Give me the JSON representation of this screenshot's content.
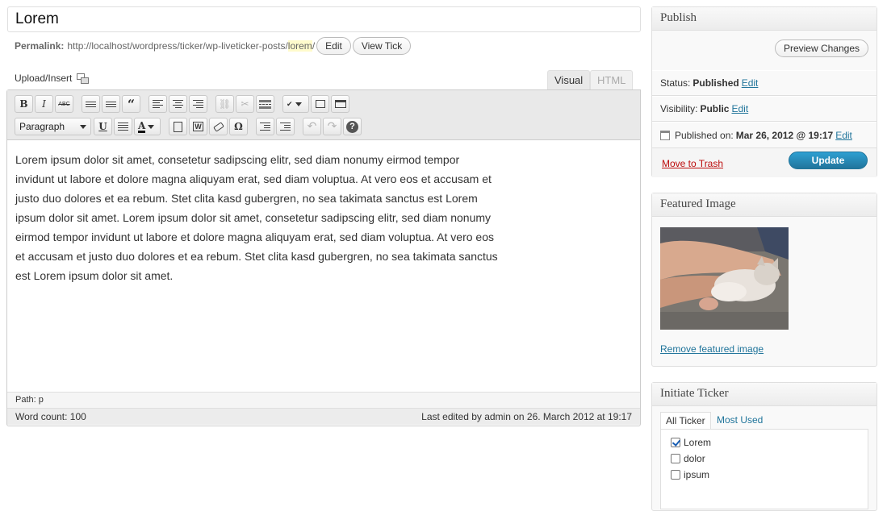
{
  "post": {
    "title": "Lorem",
    "permalink_label": "Permalink:",
    "permalink_base": "http://localhost/wordpress/ticker/wp-liveticker-posts/",
    "permalink_slug": "lorem",
    "permalink_trail": "/",
    "edit_label": "Edit",
    "view_label": "View Tick"
  },
  "editor": {
    "upload_label": "Upload/Insert",
    "tabs": [
      {
        "label": "Visual",
        "active": true
      },
      {
        "label": "HTML",
        "active": false
      }
    ],
    "format_select": "Paragraph",
    "toolbar_row1": [
      "bold-icon",
      "italic-icon",
      "strikethrough-icon",
      "bullet-list-icon",
      "numbered-list-icon",
      "blockquote-icon",
      "align-left-icon",
      "align-center-icon",
      "align-right-icon",
      "link-icon",
      "unlink-icon",
      "more-tag-icon",
      "spellcheck-icon",
      "fullscreen-icon",
      "kitchen-sink-icon"
    ],
    "toolbar_row2": [
      "underline-icon",
      "justify-icon",
      "text-color-icon",
      "paste-text-icon",
      "paste-word-icon",
      "clear-formatting-icon",
      "special-char-icon",
      "outdent-icon",
      "indent-icon",
      "undo-icon",
      "redo-icon",
      "help-icon"
    ],
    "content": "Lorem ipsum dolor sit amet, consetetur sadipscing elitr, sed diam nonumy eirmod tempor invidunt ut labore et dolore magna aliquyam erat, sed diam voluptua. At vero eos et accusam et justo duo dolores et ea rebum. Stet clita kasd gubergren, no sea takimata sanctus est Lorem ipsum dolor sit amet. Lorem ipsum dolor sit amet, consetetur sadipscing elitr, sed diam nonumy eirmod tempor invidunt ut labore et dolore magna aliquyam erat, sed diam voluptua. At vero eos et accusam et justo duo dolores et ea rebum. Stet clita kasd gubergren, no sea takimata sanctus est Lorem ipsum dolor sit amet.",
    "path_label": "Path:",
    "path_value": "p",
    "word_count": "Word count: 100",
    "last_edited": "Last edited by admin on 26. March 2012 at 19:17"
  },
  "publish": {
    "title": "Publish",
    "preview_label": "Preview Changes",
    "status_label": "Status:",
    "status_value": "Published",
    "visibility_label": "Visibility:",
    "visibility_value": "Public",
    "published_label": "Published on:",
    "published_value": "Mar 26, 2012 @ 19:17",
    "edit_label": "Edit",
    "trash_label": "Move to Trash",
    "update_label": "Update"
  },
  "featured_image": {
    "title": "Featured Image",
    "remove_label": "Remove featured image"
  },
  "ticker": {
    "title": "Initiate Ticker",
    "tabs": [
      "All Ticker",
      "Most Used"
    ],
    "items": [
      {
        "label": "Lorem",
        "checked": true
      },
      {
        "label": "dolor",
        "checked": false
      },
      {
        "label": "ipsum",
        "checked": false
      }
    ]
  },
  "colors": {
    "link": "#21759b",
    "trash": "#bc0b0b",
    "update_button": "#21759b",
    "slug_highlight": "#fffbcc"
  }
}
